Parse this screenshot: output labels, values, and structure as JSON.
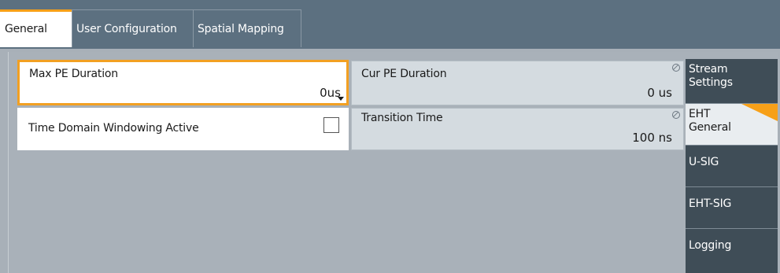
{
  "tabs": [
    {
      "label": "General"
    },
    {
      "label": "User Configuration"
    },
    {
      "label": "Spatial Mapping"
    }
  ],
  "fields": {
    "max_pe": {
      "label": "Max PE Duration",
      "value": "0us"
    },
    "cur_pe": {
      "label": "Cur PE Duration",
      "value": "0 us"
    },
    "twin": {
      "label": "Time Domain Windowing Active",
      "checked": false
    },
    "transition": {
      "label": "Transition Time",
      "value": "100 ns"
    }
  },
  "side_buttons": [
    {
      "line1": "Stream",
      "line2": "Settings"
    },
    {
      "line1": "EHT",
      "line2": "General"
    },
    {
      "label": "U-SIG"
    },
    {
      "label": "EHT-SIG"
    },
    {
      "label": "Logging"
    }
  ],
  "colors": {
    "accent": "#f7a018",
    "tabbar": "#5c7080",
    "panel": "#a9b1b9",
    "sidebutton": "#3f4d57"
  }
}
